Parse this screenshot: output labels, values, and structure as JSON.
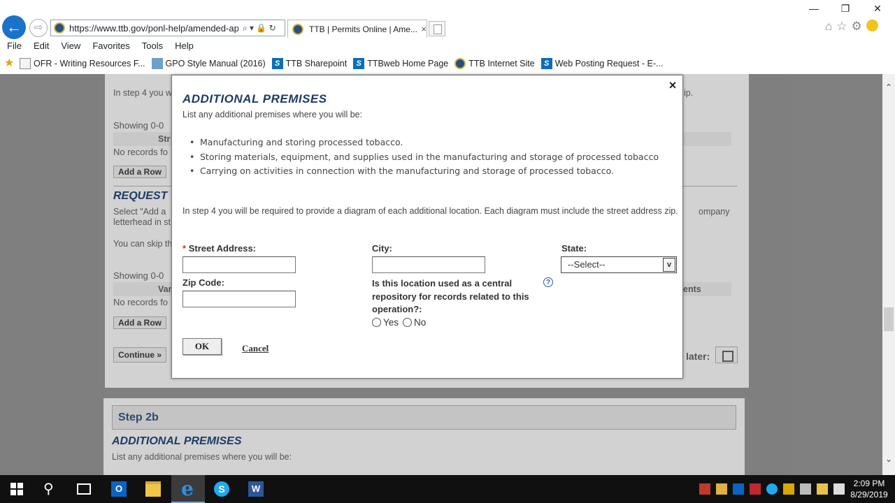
{
  "browser": {
    "url": "https://www.ttb.gov/ponl-help/amended-app",
    "address_controls": "⌕ ▾ 🔒 ↻",
    "tab_title": "TTB | Permits Online | Ame...",
    "tab_close": "×",
    "back_glyph": "←",
    "forward_glyph": "⇨",
    "window_controls": {
      "minimize": "—",
      "restore": "❐",
      "close": "✕"
    },
    "right_icons": {
      "home": "⌂",
      "favorites": "☆",
      "tools": "⚙"
    }
  },
  "menu": [
    "File",
    "Edit",
    "View",
    "Favorites",
    "Tools",
    "Help"
  ],
  "favorites_bar": [
    {
      "icon": "document-icon",
      "label": "OFR - Writing Resources F..."
    },
    {
      "icon": "gpo-icon",
      "label": "GPO Style Manual (2016)"
    },
    {
      "icon": "sharepoint-icon",
      "label": "TTB Sharepoint"
    },
    {
      "icon": "sharepoint-icon",
      "label": "TTBweb Home Page"
    },
    {
      "icon": "ttb-seal-icon",
      "label": "TTB Internet Site"
    },
    {
      "icon": "sharepoint-icon",
      "label": "Web Posting Request - E-..."
    }
  ],
  "background": {
    "step4_text": "In step 4 you w",
    "step4_tail": "ip.",
    "showing1": "Showing 0-0",
    "col1": "Str",
    "no_records1": "No records fo",
    "add_row": "Add a Row",
    "request_heading": "REQUEST",
    "select_text": "Select \"Add a",
    "letterhead": "letterhead in st",
    "company_tail": "ompany",
    "skip_text": "You can skip th",
    "showing2": "Showing 0-0",
    "col2": "Var",
    "col2_tail": "ents",
    "no_records2": "No records fo",
    "continue": "Continue »",
    "later": "later:",
    "step2b": "Step 2b",
    "step2b_heading": "ADDITIONAL PREMISES",
    "step2b_text": "List any additional premises where you will be:"
  },
  "modal": {
    "close": "×",
    "title": "ADDITIONAL PREMISES",
    "subtitle": "List any additional premises where you will be:",
    "bullets": [
      "Manufacturing and storing processed tobacco.",
      "Storing materials, equipment, and supplies used in the manufacturing and storage of processed tobacco",
      "Carrying on activities in connection with the manufacturing and storage of processed tobacco."
    ],
    "diagram_note": "In step 4 you will be required to provide a diagram of each additional location. Each diagram must include the street address zip.",
    "required_mark": "*",
    "street_label": "Street Address:",
    "city_label": "City:",
    "state_label": "State:",
    "state_value": "--Select--",
    "zip_label": "Zip Code:",
    "central_repo_label": "Is this location used as a central repository for records related to this operation?:",
    "help_glyph": "?",
    "yes": "Yes",
    "no": "No",
    "ok": "OK",
    "cancel": "Cancel"
  },
  "taskbar": {
    "outlook": "O",
    "ie": "e",
    "skype": "S",
    "word": "W",
    "time": "2:09 PM",
    "date": "8/29/2019"
  },
  "scroll": {
    "up": "⌃",
    "down": "⌄"
  },
  "colors": {
    "accent": "#1f3c64",
    "required": "#c0392b",
    "help": "#2f5faa"
  }
}
